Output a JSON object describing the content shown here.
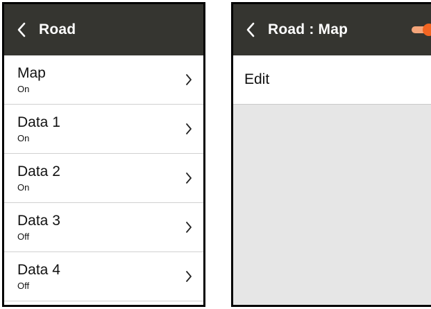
{
  "left_screen": {
    "title": "Road",
    "items": [
      {
        "label": "Map",
        "status": "On"
      },
      {
        "label": "Data 1",
        "status": "On"
      },
      {
        "label": "Data 2",
        "status": "On"
      },
      {
        "label": "Data 3",
        "status": "Off"
      },
      {
        "label": "Data 4",
        "status": "Off"
      }
    ]
  },
  "right_screen": {
    "title": "Road : Map",
    "toggle_on": true,
    "edit_label": "Edit"
  },
  "colors": {
    "header_bg": "#353530",
    "toggle_accent": "#f26522"
  },
  "icons": [
    "back-chevron-icon",
    "chevron-right-icon"
  ]
}
